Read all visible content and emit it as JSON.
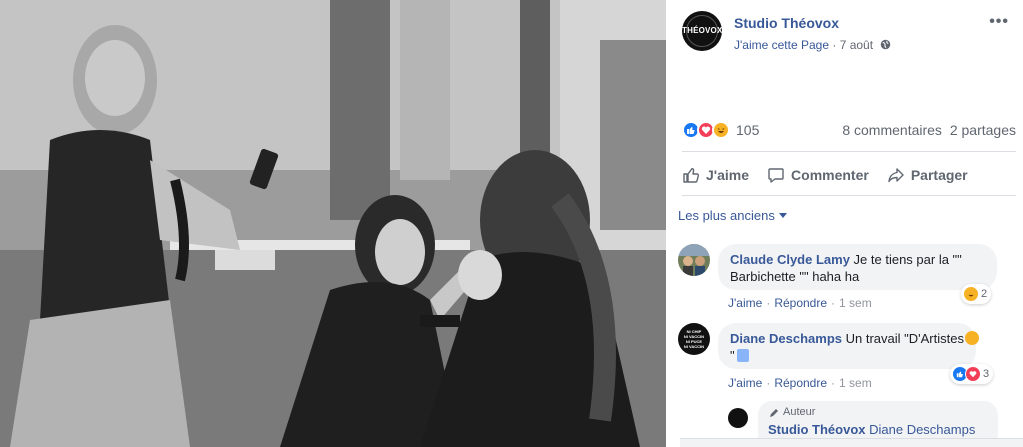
{
  "post": {
    "page_name": "Studio Théovox",
    "like_page": "J'aime cette Page",
    "meta_sep": "·",
    "date": "7 août",
    "avatar_text": "THÉOVOX",
    "more": "•••"
  },
  "stats": {
    "reaction_count": "105",
    "comments": "8 commentaires",
    "shares": "2 partages"
  },
  "actions": {
    "like": "J'aime",
    "comment": "Commenter",
    "share": "Partager"
  },
  "sort": {
    "label": "Les plus anciens"
  },
  "comments": [
    {
      "author": "Claude Clyde Lamy",
      "text": " Je te tiens par la \"\"",
      "text2": "Barbichette \"\" haha ha",
      "like": "J'aime",
      "reply": "Répondre",
      "sep": "·",
      "time": "1 sem",
      "reaction_count": "2"
    },
    {
      "author": "Diane Deschamps",
      "text": " Un travail \"D'Artistes",
      "text2": "\"",
      "like": "J'aime",
      "reply": "Répondre",
      "sep": "·",
      "time": "1 sem",
      "reaction_count": "3",
      "avatar_text": [
        "NI CHIP",
        "NI VACCIN",
        "NI PUCE",
        "NI VACCIN"
      ]
    }
  ],
  "reply": {
    "badge": "Auteur",
    "author": "Studio Théovox",
    "mention": " Diane Deschamps"
  },
  "colors": {
    "link": "#385898",
    "like_blue": "#1877f2",
    "love_red": "#f33e58",
    "haha_yellow": "#f7b125",
    "bubble": "#f2f3f5"
  }
}
